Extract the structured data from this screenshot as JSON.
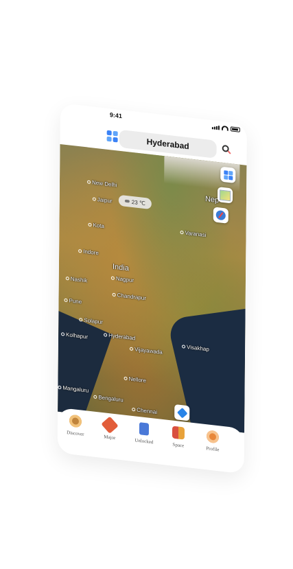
{
  "status": {
    "time": "9:41"
  },
  "search": {
    "location": "Hyderabad"
  },
  "weather": {
    "temperature": "23 ℃"
  },
  "map_labels": [
    {
      "id": "new-delhi",
      "text": "New Delhi"
    },
    {
      "id": "jaipur",
      "text": "Jaipur"
    },
    {
      "id": "kota",
      "text": "Kota"
    },
    {
      "id": "indore",
      "text": "Indore"
    },
    {
      "id": "india",
      "text": "India"
    },
    {
      "id": "nagpur",
      "text": "Nagpur"
    },
    {
      "id": "nashik",
      "text": "Nashik"
    },
    {
      "id": "chandrapur",
      "text": "Chandrapur"
    },
    {
      "id": "pune",
      "text": "Pune"
    },
    {
      "id": "solapur",
      "text": "Solapur"
    },
    {
      "id": "kolhapur",
      "text": "Kolhapur"
    },
    {
      "id": "hyderabad",
      "text": "Hyderabad"
    },
    {
      "id": "vijayawada",
      "text": "Vijayawada"
    },
    {
      "id": "visakhap",
      "text": "Visakhap"
    },
    {
      "id": "varanasi",
      "text": "Varanasi"
    },
    {
      "id": "nellore",
      "text": "Nellore"
    },
    {
      "id": "mangaluru",
      "text": "Mangaluru"
    },
    {
      "id": "bengaluru",
      "text": "Bengaluru"
    },
    {
      "id": "chennai",
      "text": "Chennai"
    },
    {
      "id": "nep",
      "text": "Nep"
    }
  ],
  "tabs": [
    {
      "label": "Discover",
      "icon": "discover-icon",
      "color": "#c0843c"
    },
    {
      "label": "Major",
      "icon": "major-icon",
      "color": "#e25d3a"
    },
    {
      "label": "Unlocked",
      "icon": "unlocked-icon",
      "color": "#4a79d8"
    },
    {
      "label": "Space",
      "icon": "space-icon",
      "color": "#d9503f"
    },
    {
      "label": "Profile",
      "icon": "profile-icon",
      "color": "#e8873a"
    }
  ],
  "colors": {
    "accent": "#2f7cf6",
    "search_bg": "#ececec"
  }
}
